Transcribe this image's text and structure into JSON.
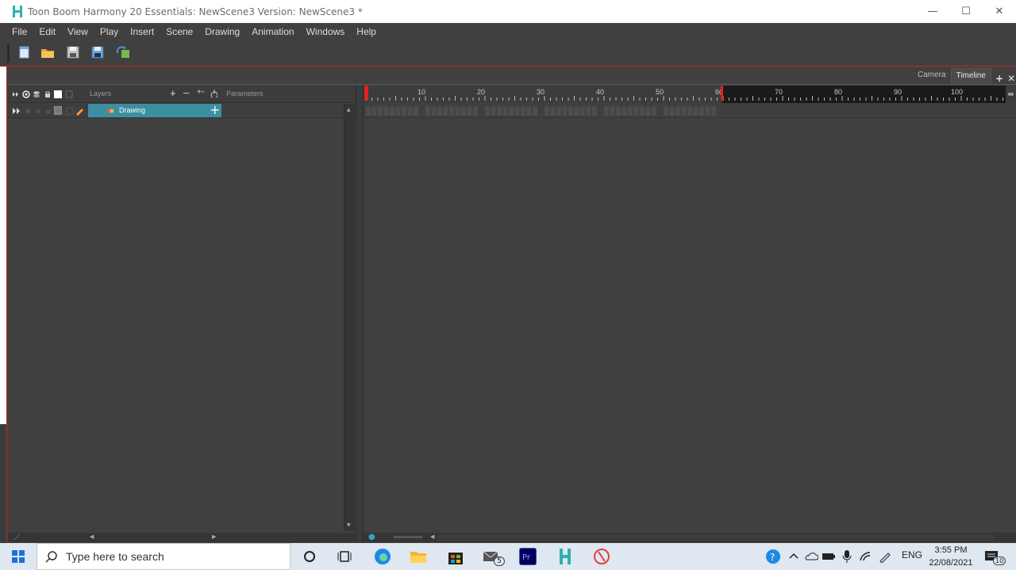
{
  "window": {
    "title": "Toon Boom Harmony 20 Essentials: NewScene3 Version: NewScene3 *",
    "controls": [
      "—",
      "☐",
      "✕"
    ]
  },
  "menu": [
    "File",
    "Edit",
    "View",
    "Play",
    "Insert",
    "Scene",
    "Drawing",
    "Animation",
    "Windows",
    "Help"
  ],
  "tabs": {
    "camera": "Camera",
    "timeline": "Timeline"
  },
  "layers_panel": {
    "layers_label": "Layers",
    "parameters_label": "Parameters",
    "rows": [
      {
        "name": "Drawing"
      }
    ]
  },
  "timeline": {
    "ruler_labels": [
      "10",
      "20",
      "30",
      "40",
      "50",
      "60",
      "70",
      "80",
      "90",
      "100"
    ],
    "current_frame": 1,
    "scene_length": 60
  },
  "taskbar": {
    "search_placeholder": "Type here to search",
    "language": "ENG",
    "time": "3:55 PM",
    "date": "22/08/2021",
    "notification_count": "10",
    "mail_badge": "5"
  }
}
